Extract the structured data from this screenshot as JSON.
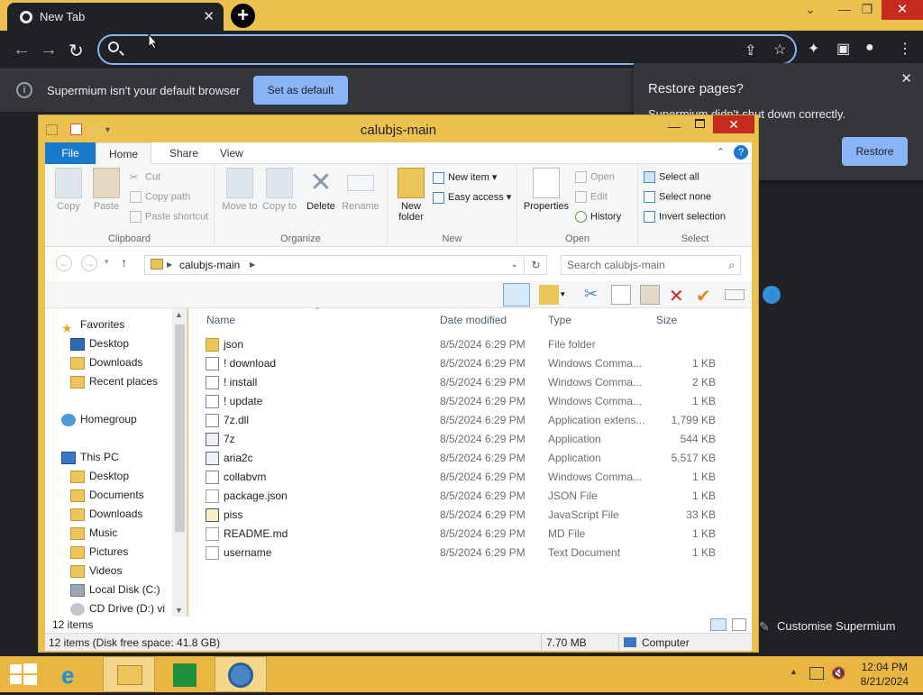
{
  "browser": {
    "tab_title": "New Tab",
    "address_value": "",
    "infobar_message": "Supermium isn't your default browser",
    "set_default_label": "Set as default",
    "restore_title": "Restore pages?",
    "restore_body": "Supermium didn't shut down correctly.",
    "restore_button": "Restore",
    "customise_label": "Customise Supermium",
    "accent": "#ecc14f"
  },
  "explorer": {
    "title": "calubjs-main",
    "tabs": [
      "File",
      "Home",
      "Share",
      "View"
    ],
    "ribbon": {
      "clipboard": {
        "label": "Clipboard",
        "copy": "Copy",
        "paste": "Paste",
        "cut": "Cut",
        "copy_path": "Copy path",
        "paste_shortcut": "Paste shortcut"
      },
      "organize": {
        "label": "Organize",
        "move_to": "Move to",
        "copy_to": "Copy to",
        "delete": "Delete",
        "rename": "Rename"
      },
      "new": {
        "label": "New",
        "new_folder": "New folder",
        "new_item": "New item",
        "easy_access": "Easy access"
      },
      "open": {
        "label": "Open",
        "properties": "Properties",
        "open": "Open",
        "edit": "Edit",
        "history": "History"
      },
      "select": {
        "label": "Select",
        "select_all": "Select all",
        "select_none": "Select none",
        "invert": "Invert selection"
      }
    },
    "address": "calubjs-main",
    "search_placeholder": "Search calubjs-main",
    "nav": {
      "favorites": "Favorites",
      "fav_items": [
        "Desktop",
        "Downloads",
        "Recent places"
      ],
      "homegroup": "Homegroup",
      "this_pc": "This PC",
      "pc_items": [
        "Desktop",
        "Documents",
        "Downloads",
        "Music",
        "Pictures",
        "Videos",
        "Local Disk (C:)",
        "CD Drive (D:) vi"
      ]
    },
    "columns": {
      "name": "Name",
      "date": "Date modified",
      "type": "Type",
      "size": "Size"
    },
    "files": [
      {
        "name": "json",
        "date": "8/5/2024 6:29 PM",
        "type": "File folder",
        "size": "",
        "icon": "folder-icon"
      },
      {
        "name": "! download",
        "date": "8/5/2024 6:29 PM",
        "type": "Windows Comma...",
        "size": "1 KB",
        "icon": "cmd-file-icon"
      },
      {
        "name": "! install",
        "date": "8/5/2024 6:29 PM",
        "type": "Windows Comma...",
        "size": "2 KB",
        "icon": "cmd-file-icon"
      },
      {
        "name": "! update",
        "date": "8/5/2024 6:29 PM",
        "type": "Windows Comma...",
        "size": "1 KB",
        "icon": "cmd-file-icon"
      },
      {
        "name": "7z.dll",
        "date": "8/5/2024 6:29 PM",
        "type": "Application extens...",
        "size": "1,799 KB",
        "icon": "dll-file-icon"
      },
      {
        "name": "7z",
        "date": "8/5/2024 6:29 PM",
        "type": "Application",
        "size": "544 KB",
        "icon": "app-file-icon"
      },
      {
        "name": "aria2c",
        "date": "8/5/2024 6:29 PM",
        "type": "Application",
        "size": "5,517 KB",
        "icon": "app-file-icon"
      },
      {
        "name": "collabvm",
        "date": "8/5/2024 6:29 PM",
        "type": "Windows Comma...",
        "size": "1 KB",
        "icon": "cmd-file-icon"
      },
      {
        "name": "package.json",
        "date": "8/5/2024 6:29 PM",
        "type": "JSON File",
        "size": "1 KB",
        "icon": "blank-file-icon"
      },
      {
        "name": "piss",
        "date": "8/5/2024 6:29 PM",
        "type": "JavaScript File",
        "size": "33 KB",
        "icon": "js-file-icon"
      },
      {
        "name": "README.md",
        "date": "8/5/2024 6:29 PM",
        "type": "MD File",
        "size": "1 KB",
        "icon": "blank-file-icon"
      },
      {
        "name": "username",
        "date": "8/5/2024 6:29 PM",
        "type": "Text Document",
        "size": "1 KB",
        "icon": "text-file-icon"
      }
    ],
    "item_count": "12 items",
    "status_left": "12 items (Disk free space: 41.8 GB)",
    "status_size": "7.70 MB",
    "status_location": "Computer"
  },
  "taskbar": {
    "time": "12:04 PM",
    "date": "8/21/2024"
  }
}
